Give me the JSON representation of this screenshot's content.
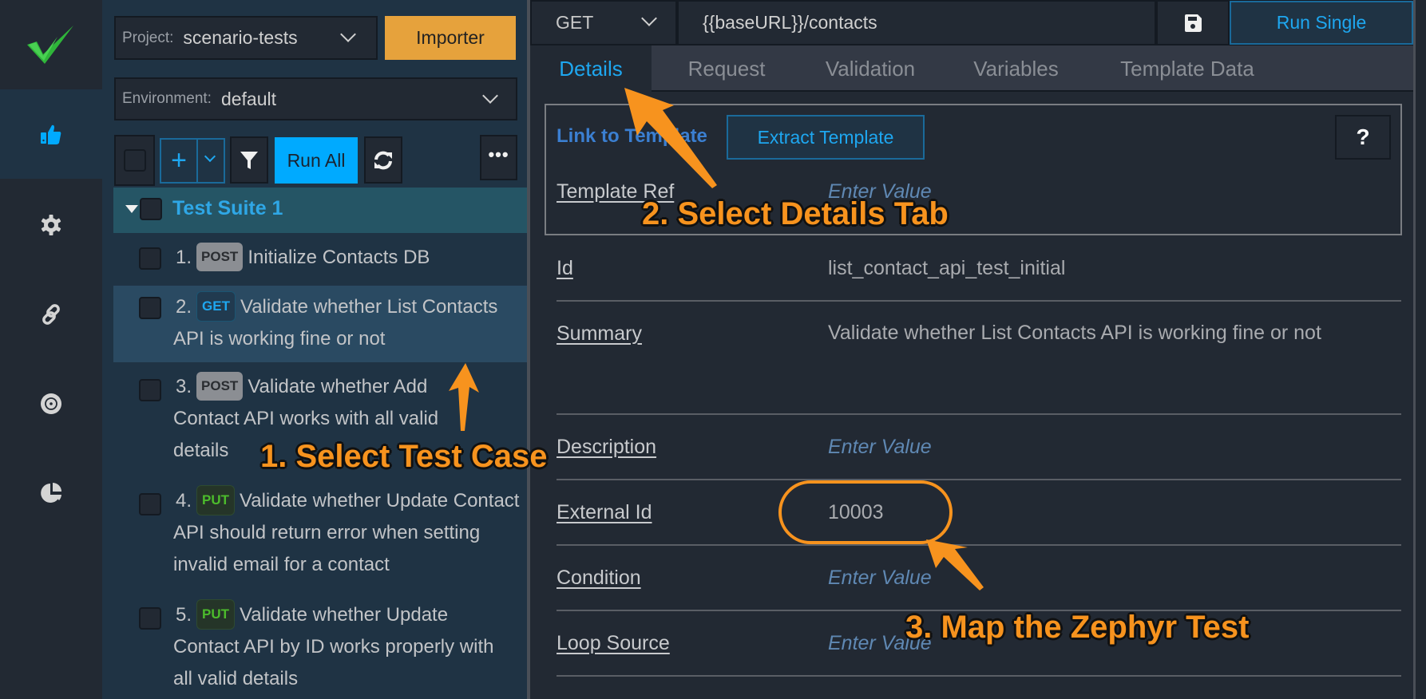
{
  "sidebar": {
    "logo_icon": "check-mark-icon",
    "items": [
      {
        "name": "thumbs-up-icon",
        "active": true
      },
      {
        "name": "gear-icon",
        "active": false
      },
      {
        "name": "link-icon",
        "active": false
      },
      {
        "name": "target-icon",
        "active": false
      },
      {
        "name": "pie-chart-icon",
        "active": false
      }
    ]
  },
  "left_panel": {
    "project": {
      "label": "Project:",
      "value": "scenario-tests"
    },
    "importer_label": "Importer",
    "environment": {
      "label": "Environment:",
      "value": "default"
    },
    "toolbar": {
      "add_icon": "plus-icon",
      "filter_icon": "filter-icon",
      "run_all_label": "Run All",
      "refresh_icon": "refresh-icon",
      "more_icon": "ellipsis-icon"
    },
    "suite": {
      "title": "Test Suite 1",
      "expanded": true
    },
    "test_cases": [
      {
        "number": "1.",
        "method": "POST",
        "title": "Initialize Contacts DB",
        "selected": false
      },
      {
        "number": "2.",
        "method": "GET",
        "title": "Validate whether List Contacts API is working fine or not",
        "selected": true
      },
      {
        "number": "3.",
        "method": "POST",
        "title": "Validate whether Add Contact API works with all valid details",
        "selected": false
      },
      {
        "number": "4.",
        "method": "PUT",
        "title": "Validate whether Update Contact API should return error when setting invalid email for a contact",
        "selected": false
      },
      {
        "number": "5.",
        "method": "PUT",
        "title": "Validate whether Update Contact API by ID works properly with all valid details",
        "selected": false
      }
    ]
  },
  "request": {
    "method": "GET",
    "url": "{{baseURL}}/contacts",
    "save_icon": "save-icon",
    "run_single_label": "Run Single"
  },
  "tabs": [
    {
      "label": "Details",
      "active": true
    },
    {
      "label": "Request",
      "active": false
    },
    {
      "label": "Validation",
      "active": false
    },
    {
      "label": "Variables",
      "active": false
    },
    {
      "label": "Template Data",
      "active": false
    }
  ],
  "template": {
    "link_label": "Link to Template",
    "extract_label": "Extract Template",
    "help_label": "?",
    "ref_label": "Template Ref",
    "ref_placeholder": "Enter Value"
  },
  "fields": [
    {
      "label": "Id",
      "value": "list_contact_api_test_initial",
      "placeholder": false
    },
    {
      "label": "Summary",
      "value": "Validate whether List Contacts API is working fine or not",
      "placeholder": false
    },
    {
      "label": "Description",
      "value": "Enter Value",
      "placeholder": true
    },
    {
      "label": "External Id",
      "value": "10003",
      "placeholder": false
    },
    {
      "label": "Condition",
      "value": "Enter Value",
      "placeholder": true
    },
    {
      "label": "Loop Source",
      "value": "Enter Value",
      "placeholder": true
    }
  ],
  "annotations": {
    "step1": "1. Select Test Case",
    "step2": "2. Select Details Tab",
    "step3": "3. Map the Zephyr Test",
    "color": "#f7931e"
  },
  "colors": {
    "accent": "#00aaff",
    "importer": "#e6a23c",
    "suite_bg": "#255565",
    "selected_bg": "#2a4a62"
  }
}
